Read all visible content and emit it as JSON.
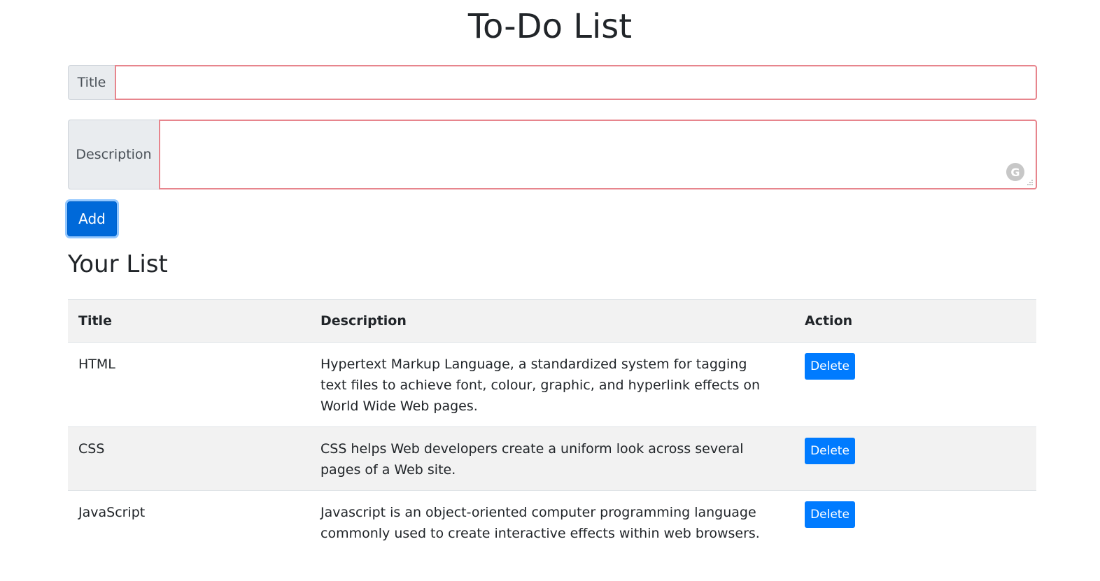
{
  "header": {
    "title": "To-Do List"
  },
  "form": {
    "title_label": "Title",
    "title_value": "",
    "description_label": "Description",
    "description_value": "",
    "grammarly_icon": "G",
    "add_label": "Add"
  },
  "list": {
    "heading": "Your List",
    "columns": [
      "Title",
      "Description",
      "Action"
    ],
    "rows": [
      {
        "title": "HTML",
        "description": "Hypertext Markup Language, a standardized system for tagging text files to achieve font, colour, graphic, and hyperlink effects on World Wide Web pages.",
        "action": "Delete"
      },
      {
        "title": "CSS",
        "description": "CSS helps Web developers create a uniform look across several pages of a Web site.",
        "action": "Delete"
      },
      {
        "title": "JavaScript",
        "description": "Javascript is an object-oriented computer programming language commonly used to create interactive effects within web browsers.",
        "action": "Delete"
      }
    ]
  },
  "colors": {
    "primary": "#007bff",
    "invalid_border": "#e7858d",
    "stripe": "#f2f2f2"
  }
}
